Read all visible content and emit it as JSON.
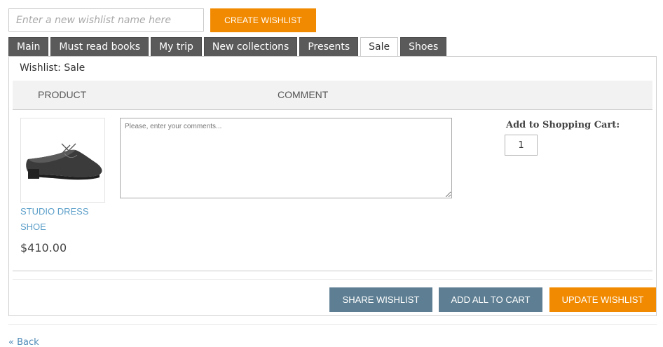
{
  "create": {
    "name_placeholder": "Enter a new wishlist name here",
    "name_value": "",
    "button_label": "CREATE WISHLIST"
  },
  "tabs": [
    {
      "label": "Main",
      "active": false
    },
    {
      "label": "Must read books",
      "active": false
    },
    {
      "label": "My trip",
      "active": false
    },
    {
      "label": "New collections",
      "active": false
    },
    {
      "label": "Presents",
      "active": false
    },
    {
      "label": "Sale",
      "active": true
    },
    {
      "label": "Shoes",
      "active": false
    }
  ],
  "wishlist": {
    "title": "Wishlist: Sale",
    "columns": {
      "product": "PRODUCT",
      "comment": "COMMENT"
    },
    "items": [
      {
        "image": "black-dress-shoe",
        "name": "STUDIO DRESS SHOE",
        "price": "$410.00",
        "comment_placeholder": "Please, enter your comments...",
        "comment_value": "",
        "cart_label": "Add to Shopping Cart:",
        "quantity": "1"
      }
    ],
    "actions": {
      "share": "SHARE WISHLIST",
      "add_all": "ADD ALL TO CART",
      "update": "UPDATE WISHLIST"
    }
  },
  "footer": {
    "back": "« Back"
  },
  "colors": {
    "accent_orange": "#f18a00",
    "button_slate": "#5e7f93",
    "tab_dark": "#5a5a5a",
    "link_blue": "#5a9ec9"
  }
}
